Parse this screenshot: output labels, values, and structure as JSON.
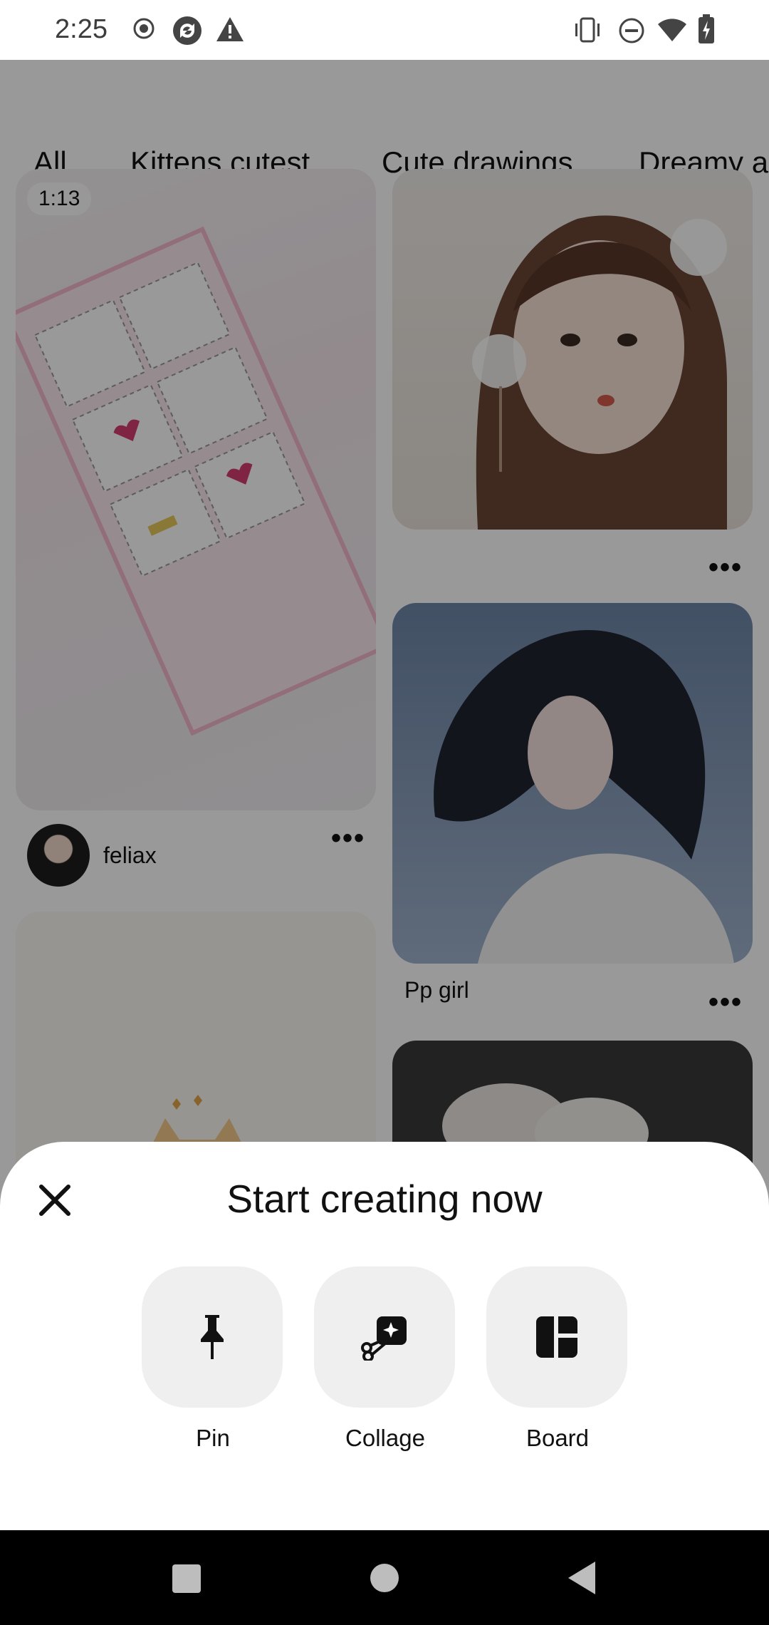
{
  "status_bar": {
    "time": "2:25",
    "left_icons": [
      "record-icon",
      "sync-icon",
      "warning-icon"
    ],
    "right_icons": [
      "vibrate-icon",
      "do-not-disturb-icon",
      "wifi-icon",
      "battery-charging-icon"
    ]
  },
  "tabs": [
    {
      "label": "All",
      "selected": true
    },
    {
      "label": "Kittens cutest"
    },
    {
      "label": "Cute drawings"
    },
    {
      "label": "Dreamy a"
    }
  ],
  "feed": {
    "video_duration": "1:13",
    "creator_name": "feliax",
    "pin_caption": "Pp girl"
  },
  "sheet": {
    "title": "Start creating now",
    "actions": [
      {
        "label": "Pin",
        "icon": "pushpin-icon"
      },
      {
        "label": "Collage",
        "icon": "collage-scissors-icon"
      },
      {
        "label": "Board",
        "icon": "board-icon"
      }
    ]
  },
  "nav": {
    "buttons": [
      "recents-square-icon",
      "home-circle-icon",
      "back-triangle-icon"
    ]
  }
}
